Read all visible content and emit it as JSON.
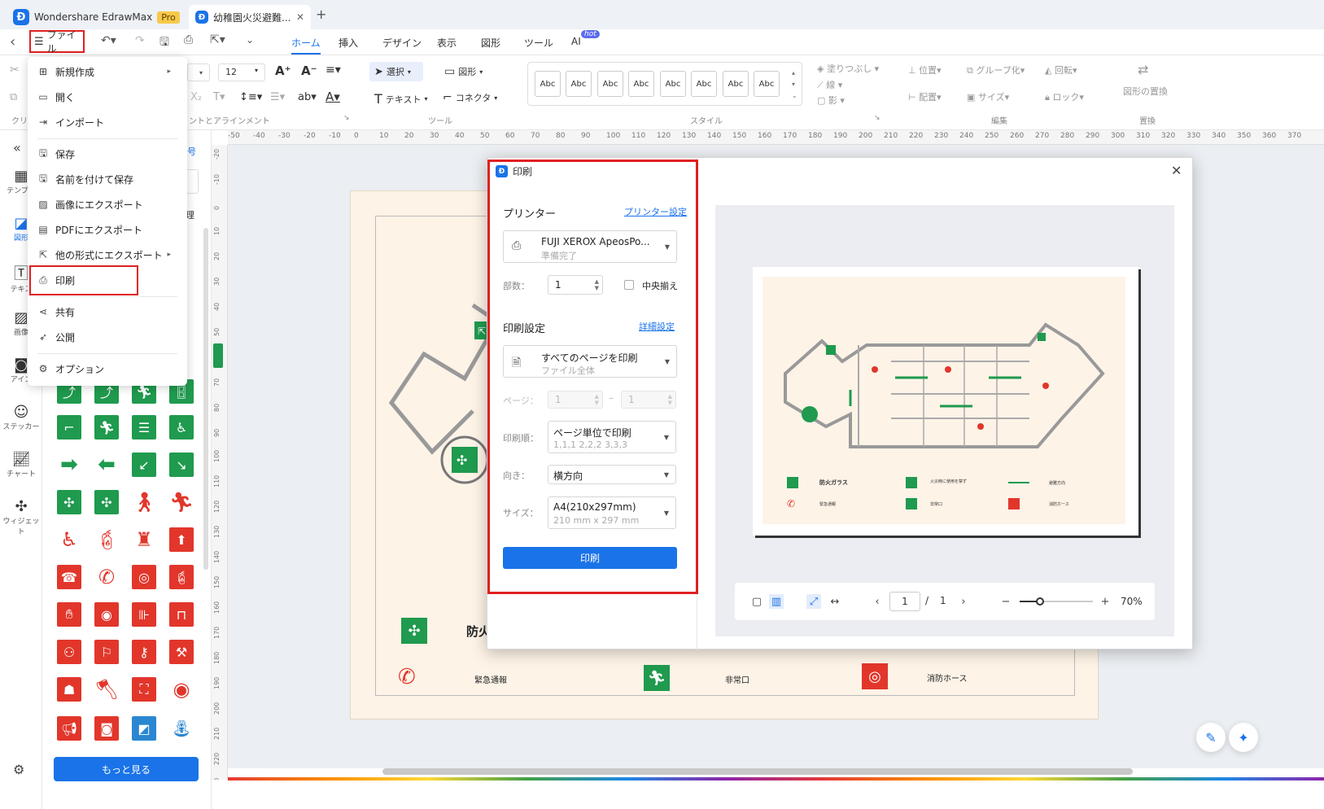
{
  "titlebar": {
    "app_name": "Wondershare EdrawMax",
    "pro_badge": "Pro",
    "doc_tab": "幼稚園火災避難...",
    "close": "✕",
    "new_tab": "+"
  },
  "menubar": {
    "back": "‹",
    "file": "ファイル",
    "tabs": [
      "ホーム",
      "挿入",
      "デザイン",
      "表示",
      "図形",
      "ツール",
      "AI"
    ],
    "ai_badge": "hot"
  },
  "ribbon": {
    "font_size": "12",
    "section_font": "ントとアラインメント",
    "select_label": "選択",
    "shape_label": "図形",
    "text_label": "テキスト",
    "connector_label": "コネクタ",
    "section_tools": "ツール",
    "abc": [
      "Abc",
      "Abc",
      "Abc",
      "Abc",
      "Abc",
      "Abc",
      "Abc",
      "Abc"
    ],
    "section_style": "スタイル",
    "fill_label": "塗りつぶし",
    "line_label": "線",
    "shadow_label": "影",
    "position_label": "位置",
    "group_label": "グループ化",
    "rotate_label": "回転",
    "align_label": "配置",
    "size_label": "サイズ",
    "lock_label": "ロック",
    "section_edit": "編集",
    "replace_shape_label": "図形の置換",
    "section_replace": "置換",
    "clip_label": "クリ"
  },
  "rail": [
    {
      "label": "テンプレ",
      "icon": "template-icon"
    },
    {
      "label": "図形",
      "icon": "shapes-icon"
    },
    {
      "label": "テキス",
      "icon": "text-icon"
    },
    {
      "label": "画像",
      "icon": "image-icon"
    },
    {
      "label": "アイコ",
      "icon": "icon-library-icon"
    },
    {
      "label": "ステッカー",
      "icon": "sticker-icon"
    },
    {
      "label": "チャート",
      "icon": "chart-icon"
    },
    {
      "label": "ウィジェット",
      "icon": "widget-icon"
    }
  ],
  "symbolpanel": {
    "partial_label_1": "号",
    "partial_label_2": "理",
    "more_button": "もっと見る"
  },
  "filemenu": {
    "items": [
      {
        "label": "新規作成",
        "icon": "new-icon",
        "submenu": true
      },
      {
        "label": "開く",
        "icon": "folder-icon",
        "submenu": false
      },
      {
        "label": "インポート",
        "icon": "import-icon",
        "submenu": false
      },
      {
        "label": "保存",
        "icon": "save-icon",
        "submenu": false
      },
      {
        "label": "名前を付けて保存",
        "icon": "save-as-icon",
        "submenu": false
      },
      {
        "label": "画像にエクスポート",
        "icon": "export-image-icon",
        "submenu": false
      },
      {
        "label": "PDFにエクスポート",
        "icon": "export-pdf-icon",
        "submenu": false
      },
      {
        "label": "他の形式にエクスポート",
        "icon": "export-other-icon",
        "submenu": true
      },
      {
        "label": "印刷",
        "icon": "print-icon",
        "submenu": false
      },
      {
        "label": "共有",
        "icon": "share-icon",
        "submenu": false
      },
      {
        "label": "公開",
        "icon": "publish-icon",
        "submenu": false
      },
      {
        "label": "オプション",
        "icon": "gear-icon",
        "submenu": false
      }
    ]
  },
  "canvas": {
    "legend_fireproof_partial": "防火",
    "legend_emergency": "緊急通報",
    "legend_exit": "非常口",
    "legend_hose": "消防ホース"
  },
  "print_dialog": {
    "title": "印刷",
    "printer_heading": "プリンター",
    "printer_settings_link": "プリンター設定",
    "printer_name": "FUJI XEROX ApeosPo...",
    "printer_status": "準備完了",
    "copies_label": "部数：",
    "copies_value": "1",
    "center_label": "中央揃え",
    "settings_heading": "印刷設定",
    "details_link": "詳細設定",
    "range_main": "すべてのページを印刷",
    "range_sub": "ファイル全体",
    "pages_label": "ページ：",
    "page_from": "1",
    "page_dash": "–",
    "page_to": "1",
    "order_label": "印刷順：",
    "order_main": "ページ単位で印刷",
    "order_sub": "1,1,1 2,2,2 3,3,3",
    "orientation_label": "向き：",
    "orientation_value": "横方向",
    "size_label": "サイズ：",
    "size_main": "A4(210x297mm)",
    "size_sub": "210 mm x 297 mm",
    "print_button": "印刷",
    "preview_legend": [
      "防火ガラス",
      "火災時に使用を禁ず",
      "避難方向",
      "緊急通報",
      "非常口",
      "消防ホース"
    ],
    "page_current": "1",
    "page_sep": "/",
    "page_total": "1",
    "zoom": "70%"
  },
  "colors": {
    "accent": "#1a73e8",
    "highlight": "#e02020",
    "safety_green": "#1f9a4e",
    "fire_red": "#e2362b",
    "paper": "#fdf3e7"
  }
}
